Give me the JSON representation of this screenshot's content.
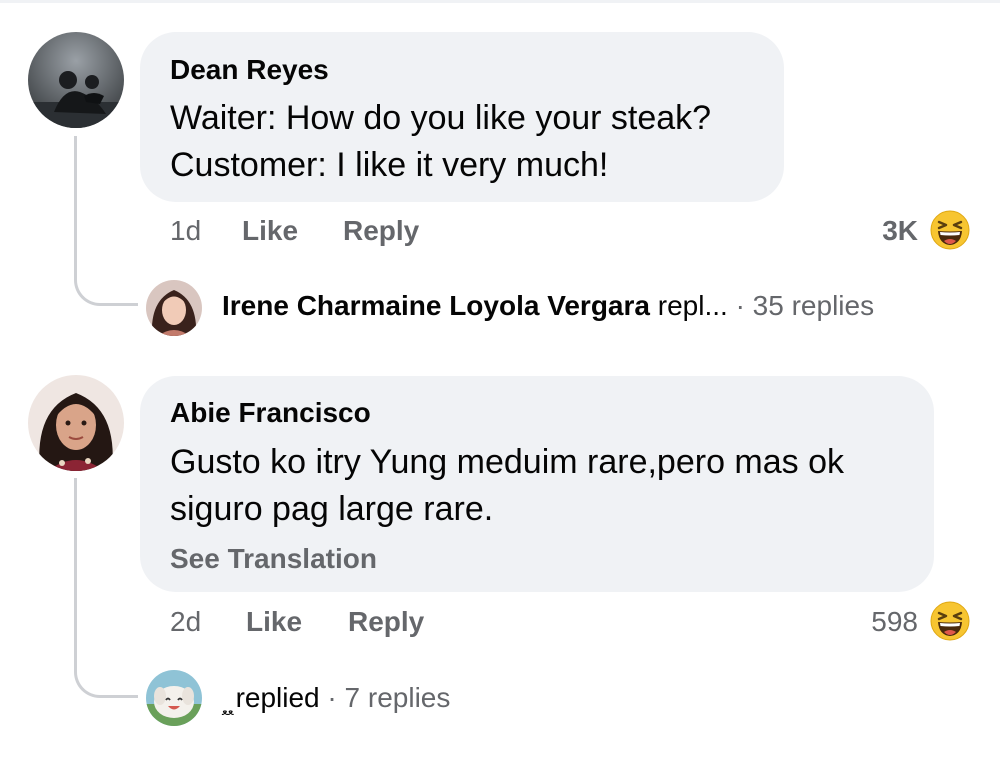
{
  "comments": [
    {
      "author": "Dean Reyes",
      "lines": [
        "Waiter: How do you like your steak?",
        "Customer: I like it very much!"
      ],
      "time": "1d",
      "like_label": "Like",
      "reply_label": "Reply",
      "reaction_count": "3K",
      "reaction_icon": "laughing-emoji-icon",
      "reply_preview": {
        "name": "Irene Charmaine Loyola Vergara",
        "verb": "repl...",
        "separator": "·",
        "replies": "35 replies"
      }
    },
    {
      "author": "Abie Francisco",
      "lines": [
        "Gusto ko itry Yung meduim rare,pero mas ok",
        "siguro pag large rare."
      ],
      "see_translation": "See Translation",
      "time": "2d",
      "like_label": "Like",
      "reply_label": "Reply",
      "reaction_count": "598",
      "reaction_icon": "laughing-emoji-icon",
      "reply_preview": {
        "name_script": "ﻌﻌ",
        "verb": "replied",
        "separator": "·",
        "replies": "7 replies"
      }
    }
  ],
  "colors": {
    "bubble": "#f0f2f5",
    "text": "#050505",
    "secondary": "#65676b",
    "thread_line": "#ced0d4",
    "emoji_yellow": "#f7c531"
  }
}
